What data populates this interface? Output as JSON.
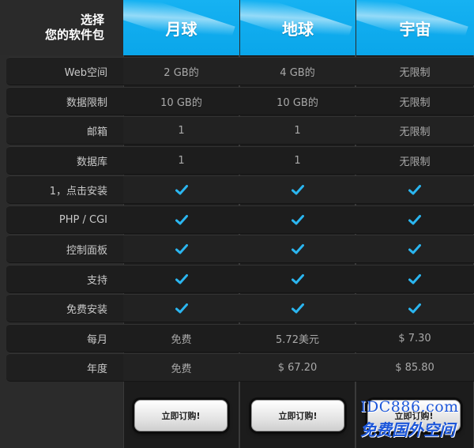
{
  "header": {
    "title_line1": "选择",
    "title_line2": "您的软件包"
  },
  "plans": [
    {
      "name": "月球",
      "button": "立即订购!"
    },
    {
      "name": "地球",
      "button": "立即订购!"
    },
    {
      "name": "宇宙",
      "button": "立即订购!"
    }
  ],
  "rows": [
    {
      "label": "Web空间",
      "values": [
        "2 GB的",
        "4 GB的",
        "无限制"
      ]
    },
    {
      "label": "数据限制",
      "values": [
        "10 GB的",
        "10 GB的",
        "无限制"
      ]
    },
    {
      "label": "邮箱",
      "values": [
        "1",
        "1",
        "无限制"
      ]
    },
    {
      "label": "数据库",
      "values": [
        "1",
        "1",
        "无限制"
      ]
    },
    {
      "label": "1，点击安装",
      "values": [
        "check",
        "check",
        "check"
      ]
    },
    {
      "label": "PHP / CGI",
      "values": [
        "check",
        "check",
        "check"
      ]
    },
    {
      "label": "控制面板",
      "values": [
        "check",
        "check",
        "check"
      ]
    },
    {
      "label": "支持",
      "values": [
        "check",
        "check",
        "check"
      ]
    },
    {
      "label": "免费安装",
      "values": [
        "check",
        "check",
        "check"
      ]
    },
    {
      "label": "每月",
      "values": [
        "免费",
        "5.72美元",
        "$ 7.30"
      ]
    },
    {
      "label": "年度",
      "values": [
        "免费",
        "$ 67.20",
        "$ 85.80"
      ]
    }
  ],
  "watermark": {
    "line1": "IDC886.com",
    "line2": "免费国外空间"
  },
  "colors": {
    "accent": "#12aef0",
    "check": "#2bb6f0",
    "background": "#2b2b2b"
  },
  "icons": {
    "check": "check-icon"
  }
}
